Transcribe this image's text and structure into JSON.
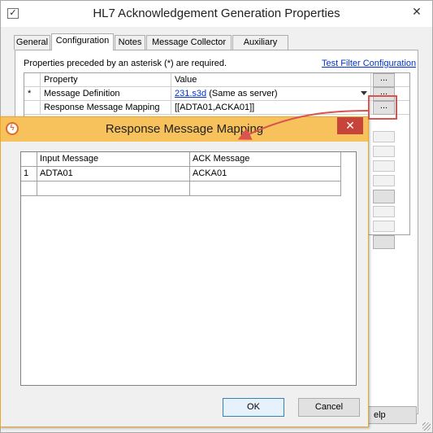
{
  "main_window": {
    "title": "HL7 Acknowledgement Generation Properties",
    "close_glyph": "✕",
    "tabs": [
      {
        "label": "General"
      },
      {
        "label": "Configuration"
      },
      {
        "label": "Notes"
      },
      {
        "label": "Message Collector"
      },
      {
        "label": "Auxiliary Files"
      }
    ],
    "active_tab": "Configuration",
    "required_note": "Properties preceded by an asterisk (*) are required.",
    "test_filter_link": "Test Filter Configuration",
    "grid": {
      "headers": {
        "property": "Property",
        "value": "Value"
      },
      "rows": [
        {
          "marker": "*",
          "property": "Message Definition",
          "value_link": "231.s3d",
          "value_rest": " (Same as server)",
          "button": "..."
        },
        {
          "marker": "",
          "property": "Response Message Mapping",
          "value": "[[ADTA01,ACKA01]]",
          "button": "..."
        }
      ],
      "header_button": "..."
    },
    "partial_button_label": "elp"
  },
  "dialog": {
    "title": "Response Message Mapping",
    "close_glyph": "✕",
    "table": {
      "headers": [
        "Input Message",
        "ACK Message"
      ],
      "rows": [
        {
          "index": "1",
          "input": "ADTA01",
          "ack": "ACKA01"
        },
        {
          "index": "",
          "input": "",
          "ack": ""
        }
      ]
    },
    "ok_label": "OK",
    "cancel_label": "Cancel"
  },
  "colors": {
    "dialog_title_bg": "#f7c25c",
    "dialog_close_bg": "#c7443b",
    "link": "#0033cc",
    "annotation": "#d9534f"
  },
  "icons": {
    "main_window": "check-square-icon",
    "dialog": "lightning-circle-icon"
  }
}
